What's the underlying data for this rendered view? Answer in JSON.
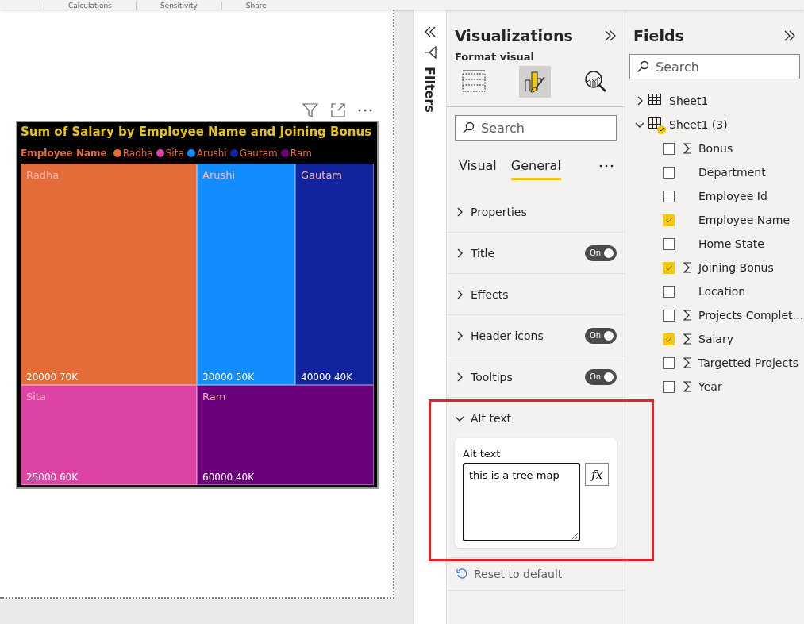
{
  "ribbon": {
    "groups": [
      "Calculations",
      "Sensitivity",
      "Share"
    ]
  },
  "visual": {
    "title": "Sum of Salary by Employee Name and Joining Bonus",
    "legend_title": "Employee Name",
    "legend": [
      {
        "name": "Radha",
        "color": "#e46c38"
      },
      {
        "name": "Sita",
        "color": "#de44a6"
      },
      {
        "name": "Arushi",
        "color": "#118dff"
      },
      {
        "name": "Gautam",
        "color": "#12239e"
      },
      {
        "name": "Ram",
        "color": "#6b007b"
      }
    ],
    "tiles": [
      {
        "name": "Radha",
        "values": "20000 70K",
        "color": "#e46c38"
      },
      {
        "name": "Arushi",
        "values": "30000 50K",
        "color": "#118dff"
      },
      {
        "name": "Gautam",
        "values": "40000 40K",
        "color": "#12239e"
      },
      {
        "name": "Sita",
        "values": "25000 60K",
        "color": "#de44a6"
      },
      {
        "name": "Ram",
        "values": "60000 40K",
        "color": "#6b007b"
      }
    ]
  },
  "filters": {
    "label": "Filters"
  },
  "visualizations": {
    "title": "Visualizations",
    "subtitle": "Format visual",
    "format_tabs": [
      {
        "kind": "build",
        "selected": false
      },
      {
        "kind": "format",
        "selected": true
      },
      {
        "kind": "analytics",
        "selected": false
      }
    ],
    "search": {
      "placeholder": "Search"
    },
    "tabs": [
      {
        "label": "Visual",
        "selected": false
      },
      {
        "label": "General",
        "selected": true
      }
    ],
    "sections": [
      {
        "label": "Properties",
        "expanded": false
      },
      {
        "label": "Title",
        "expanded": false,
        "toggle": {
          "label": "On",
          "on": true
        }
      },
      {
        "label": "Effects",
        "expanded": false
      },
      {
        "label": "Header icons",
        "expanded": false,
        "toggle": {
          "label": "On",
          "on": true
        }
      },
      {
        "label": "Tooltips",
        "expanded": false,
        "toggle": {
          "label": "On",
          "on": true
        }
      },
      {
        "label": "Alt text",
        "expanded": true,
        "field_label": "Alt text",
        "value": "this is a tree map",
        "fx": "fx"
      }
    ],
    "reset": "Reset to default"
  },
  "fields": {
    "title": "Fields",
    "search": {
      "placeholder": "Search"
    },
    "tables": [
      {
        "name": "Sheet1",
        "expanded": false,
        "in_use": false
      },
      {
        "name": "Sheet1 (3)",
        "expanded": true,
        "in_use": true,
        "children": [
          {
            "name": "Bonus",
            "aggregate": true,
            "checked": false
          },
          {
            "name": "Department",
            "aggregate": false,
            "checked": false
          },
          {
            "name": "Employee Id",
            "aggregate": false,
            "checked": false
          },
          {
            "name": "Employee Name",
            "aggregate": false,
            "checked": true
          },
          {
            "name": "Home State",
            "aggregate": false,
            "checked": false
          },
          {
            "name": "Joining Bonus",
            "aggregate": true,
            "checked": true
          },
          {
            "name": "Location",
            "aggregate": false,
            "checked": false
          },
          {
            "name": "Projects Complet…",
            "aggregate": true,
            "checked": false
          },
          {
            "name": "Salary",
            "aggregate": true,
            "checked": true
          },
          {
            "name": "Targetted Projects",
            "aggregate": true,
            "checked": false
          },
          {
            "name": "Year",
            "aggregate": true,
            "checked": false
          }
        ]
      }
    ]
  }
}
